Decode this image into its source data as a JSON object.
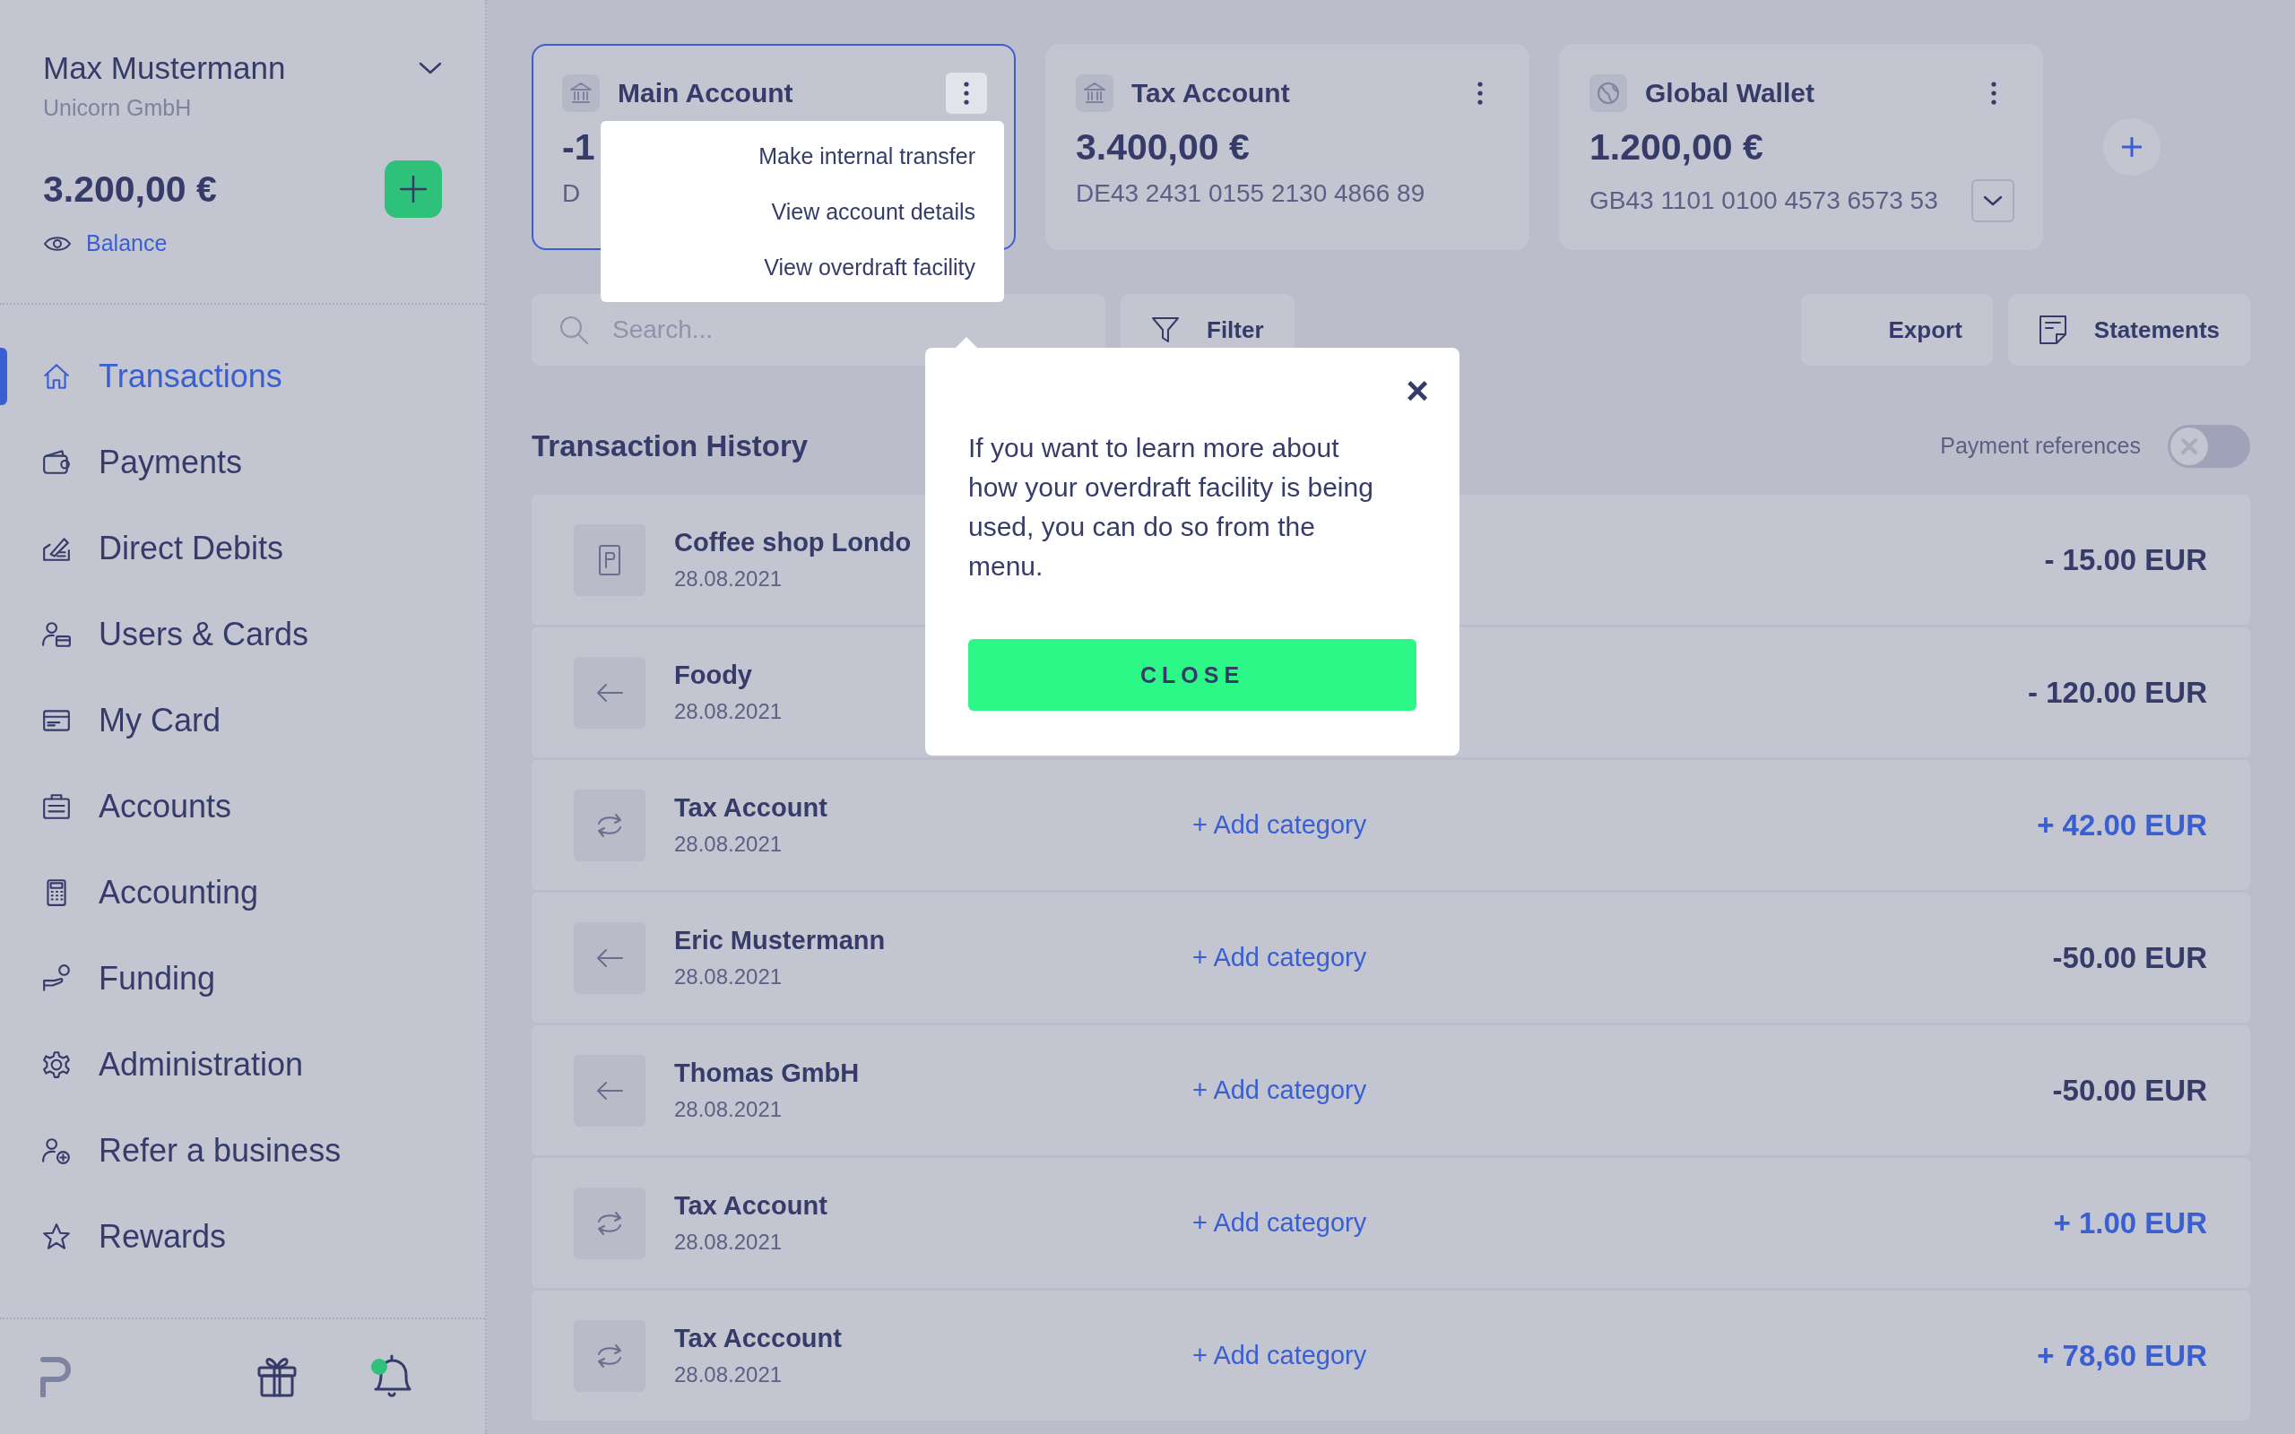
{
  "user": {
    "name": "Max Mustermann",
    "company": "Unicorn GmbH",
    "balance": "3.200,00 €",
    "balance_label": "Balance"
  },
  "nav": [
    {
      "label": "Transactions",
      "selected": true
    },
    {
      "label": "Payments",
      "selected": false
    },
    {
      "label": "Direct Debits",
      "selected": false
    },
    {
      "label": "Users & Cards",
      "selected": false
    },
    {
      "label": "My Card",
      "selected": false
    },
    {
      "label": "Accounts",
      "selected": false
    },
    {
      "label": "Accounting",
      "selected": false
    },
    {
      "label": "Funding",
      "selected": false
    },
    {
      "label": "Administration",
      "selected": false
    },
    {
      "label": "Refer a business",
      "selected": false
    },
    {
      "label": "Rewards",
      "selected": false
    }
  ],
  "footer": {
    "notifications_unread": true
  },
  "accounts": [
    {
      "name": "Main Account",
      "amount": "-1",
      "iban": "D",
      "selected": true,
      "expandable": false,
      "menu": [
        "Make internal transfer",
        "View account details",
        "View overdraft facility"
      ]
    },
    {
      "name": "Tax Account",
      "amount": "3.400,00 €",
      "iban": "DE43 2431 0155 2130 4866 89",
      "selected": false,
      "expandable": false
    },
    {
      "name": "Global Wallet",
      "amount": "1.200,00 €",
      "iban": "GB43 1101 0100 4573 6573 53",
      "selected": false,
      "expandable": true
    }
  ],
  "toolbar": {
    "search_placeholder": "Search...",
    "filter": "Filter",
    "export": "Export",
    "statements": "Statements"
  },
  "history": {
    "title": "Transaction History",
    "payment_references": {
      "label": "Payment references",
      "on": false
    }
  },
  "transactions": [
    {
      "kind": "card",
      "name": "Coffee shop Londo",
      "date": "28.08.2021",
      "amount": "- 15.00 EUR",
      "credit": false
    },
    {
      "kind": "outgoing",
      "name": "Foody",
      "date": "28.08.2021",
      "amount": "- 120.00 EUR",
      "credit": false
    },
    {
      "kind": "transfer",
      "name": "Tax Account",
      "date": "28.08.2021",
      "category": "+ Add category",
      "amount": "+ 42.00 EUR",
      "credit": true
    },
    {
      "kind": "outgoing",
      "name": "Eric Mustermann",
      "date": "28.08.2021",
      "category": "+ Add category",
      "amount": "-50.00 EUR",
      "credit": false
    },
    {
      "kind": "outgoing",
      "name": "Thomas GmbH",
      "date": "28.08.2021",
      "category": "+ Add category",
      "amount": "-50.00 EUR",
      "credit": false
    },
    {
      "kind": "transfer",
      "name": "Tax Account",
      "date": "28.08.2021",
      "category": "+ Add category",
      "amount": "+ 1.00 EUR",
      "credit": true
    },
    {
      "kind": "transfer",
      "name": "Tax Acccount",
      "date": "28.08.2021",
      "category": "+ Add category",
      "amount": "+ 78,60 EUR",
      "credit": true
    }
  ],
  "popover": {
    "text": "If you want to learn more about how your overdraft facility is being used, you can do so from the menu.",
    "button": "CLOSE",
    "close": "×"
  }
}
